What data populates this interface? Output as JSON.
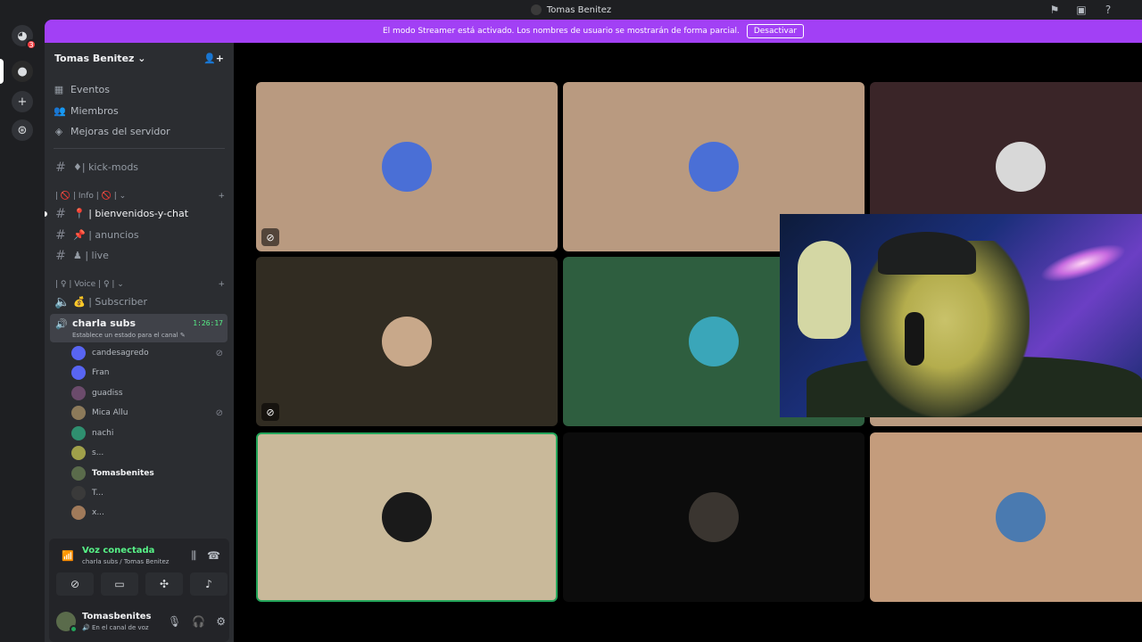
{
  "window": {
    "title": "Tomas Benitez"
  },
  "servers": {
    "badge_count": "3"
  },
  "banner": {
    "text": "El modo Streamer está activado. Los nombres de usuario se mostrarán de forma parcial.",
    "button_label": "Desactivar"
  },
  "server": {
    "name": "Tomas Benitez ⌄",
    "nav": [
      {
        "label": "Eventos",
        "icon": "calendar-icon"
      },
      {
        "label": "Miembros",
        "icon": "members-icon"
      },
      {
        "label": "Mejoras del servidor",
        "icon": "boost-icon"
      }
    ],
    "channels_top": [
      {
        "label": "♦| kick-mods"
      }
    ],
    "category_info": "| 🚫 | Info | 🚫 |  ⌄",
    "text_channels": [
      {
        "label": "📍 | bienvenidos-y-chat"
      },
      {
        "label": "📌 | anuncios"
      },
      {
        "label": "♟ | live"
      }
    ],
    "category_voice": "| ♀ | Voice | ♀ |  ⌄",
    "voice_channels": [
      {
        "label": "💰 | Subscriber"
      }
    ],
    "active_voice": {
      "name": "charla subs",
      "status": "Establece un estado para el canal ✎",
      "time": "1:26:17"
    },
    "members": [
      {
        "name": "candesagredo",
        "muted": true,
        "color": "#5865f2"
      },
      {
        "name": "Fran",
        "muted": false,
        "color": "#5865f2"
      },
      {
        "name": "guadiss",
        "muted": false,
        "color": "#6b4b6b"
      },
      {
        "name": "Mica Allu",
        "muted": true,
        "color": "#8c7a5a"
      },
      {
        "name": "nachi",
        "muted": false,
        "color": "#2f8f6f"
      },
      {
        "name": "s...",
        "muted": false,
        "color": "#a0a04a"
      },
      {
        "name": "Tomasbenites",
        "muted": false,
        "color": "#5a6b4b"
      },
      {
        "name": "T...",
        "muted": false,
        "color": "#3a3a3a"
      },
      {
        "name": "x...",
        "muted": false,
        "color": "#a07a5a"
      }
    ]
  },
  "voice_panel": {
    "title": "Voz conectada",
    "subtitle": "charla subs / Tomas Benitez"
  },
  "user": {
    "name": "Tomasbenites",
    "status": "🔊 En el canal de voz"
  },
  "tiles": [
    {
      "bg": "#b99a80",
      "avatar": "#4a6fd6",
      "muted": true
    },
    {
      "bg": "#b99a80",
      "avatar": "#4a6fd6",
      "muted": false
    },
    {
      "bg": "#3a2528",
      "avatar": "#d8d8d8",
      "muted": false
    },
    {
      "bg": "#312c22",
      "avatar": "#c8a88a",
      "muted": true
    },
    {
      "bg": "#2e5e3f",
      "avatar": "#3aa6b9",
      "muted": false
    },
    {
      "bg": "#b99a80",
      "avatar": "#c9c26a",
      "muted": false
    },
    {
      "bg": "#c9b99a",
      "avatar": "#1a1a1a",
      "muted": false
    },
    {
      "bg": "#0c0c0c",
      "avatar": "#3a3530",
      "muted": false
    },
    {
      "bg": "#c49c7c",
      "avatar": "#4a7ab0",
      "muted": false
    }
  ]
}
